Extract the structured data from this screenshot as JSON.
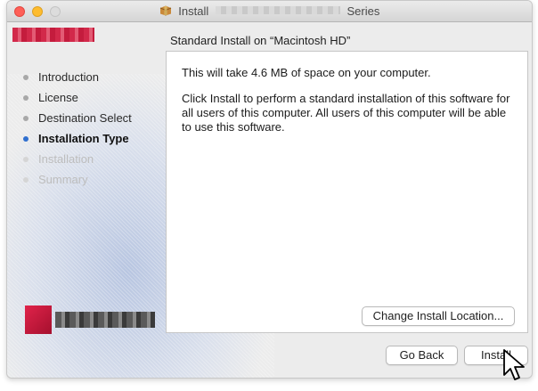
{
  "window": {
    "title_prefix": "Install",
    "title_suffix": "Series"
  },
  "header": {
    "heading": "Standard Install on “Macintosh HD”"
  },
  "sidebar": {
    "steps": [
      {
        "label": "Introduction",
        "state": "done"
      },
      {
        "label": "License",
        "state": "done"
      },
      {
        "label": "Destination Select",
        "state": "done"
      },
      {
        "label": "Installation Type",
        "state": "active"
      },
      {
        "label": "Installation",
        "state": "future"
      },
      {
        "label": "Summary",
        "state": "future"
      }
    ]
  },
  "content": {
    "space_text": "This will take 4.6 MB of space on your computer.",
    "instruction_text": "Click Install to perform a standard installation of this software for all users of this computer. All users of this computer will be able to use this software.",
    "change_location_label": "Change Install Location..."
  },
  "footer": {
    "back_label": "Go Back",
    "install_label": "Install"
  },
  "colors": {
    "active_step": "#2f6fcf",
    "close": "#fe5f57",
    "minimize": "#febc2e",
    "brand_red": "#d2294a"
  },
  "icons": {
    "title_icon": "package-icon",
    "pointer": "mouse-pointer-icon"
  }
}
